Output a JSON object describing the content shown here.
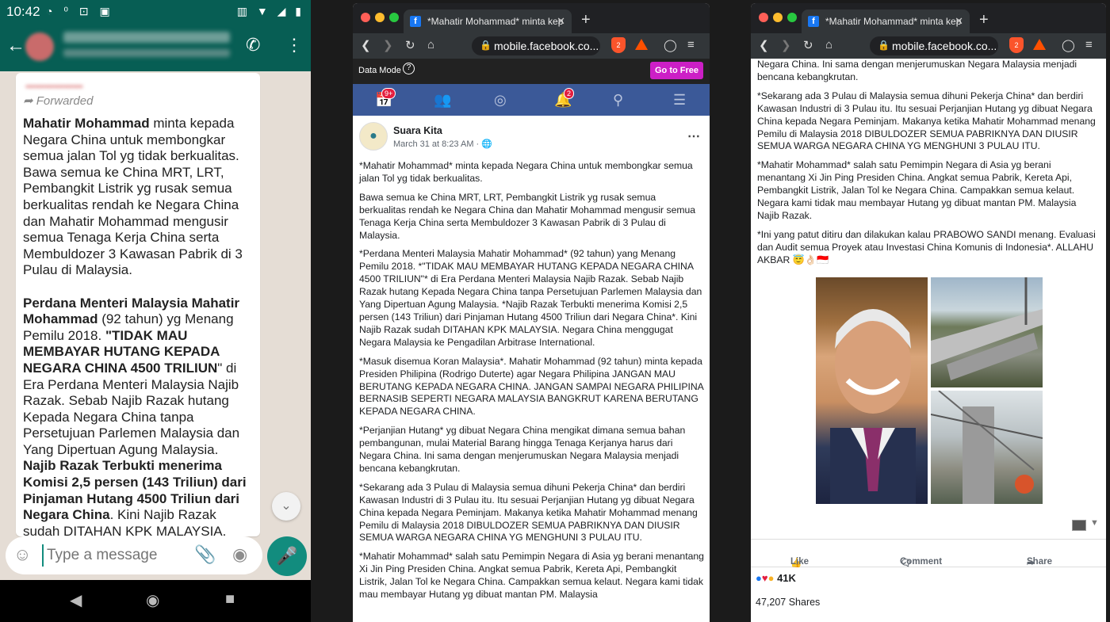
{
  "whatsapp": {
    "status_time": "10:42",
    "status_left_icons": "◔ ⁰ ⊡ ▣",
    "status_right_icons": "▥ ▼ ◢ ▮",
    "back_icon": "arrow-left-icon",
    "forwarded_label": "Forwarded",
    "message": {
      "p1_bold": "Mahatir Mohammad",
      "p1_rest": " minta kepada Negara China untuk membongkar semua jalan Tol yg tidak berkualitas. Bawa semua ke China MRT, LRT, Pembangkit Listrik yg rusak semua berkualitas rendah ke Negara China dan Mahatir Mohammad mengusir semua Tenaga Kerja China serta Membuldozer 3 Kawasan Pabrik di 3 Pulau di Malaysia.",
      "p2_bold": "Perdana Menteri Malaysia Mahatir Mohammad",
      "p2_a": " (92 tahun) yg Menang Pemilu 2018. ",
      "p2_bold2": "\"TIDAK MAU MEMBAYAR HUTANG KEPADA NEGARA CHINA 4500 TRILIUN",
      "p2_b": "\" di Era Perdana Menteri Malaysia Najib Razak. Sebab Najib Razak hutang Kepada Negara China tanpa Persetujuan Parlemen Malaysia dan Yang Dipertuan Agung Malaysia. ",
      "p2_bold3": "Najib Razak Terbukti menerima Komisi 2,5 persen (143 Triliun) dari Pinjaman Hutang 4500 Triliun dari Negara China",
      "p2_c": ". Kini Najib Razak sudah DITAHAN KPK MALAYSIA. Negara"
    },
    "input_placeholder": "Type a message",
    "nav": [
      "◀",
      "◉",
      "■"
    ]
  },
  "browser_left": {
    "tab_title": "*Mahatir Mohammad* minta kep",
    "url": "mobile.facebook.co...",
    "brave_count": "2",
    "data_mode_label": "Data Mode",
    "go_free_label": "Go to Free",
    "badge_home": "9+",
    "badge_notif": "2",
    "post": {
      "page_name": "Suara Kita",
      "date": "March 31 at 8:23 AM · ",
      "paragraphs": [
        "*Mahatir Mohammad* minta kepada Negara China untuk membongkar semua jalan Tol yg tidak berkualitas.",
        "Bawa semua ke China MRT, LRT, Pembangkit Listrik yg rusak semua berkualitas rendah ke Negara China dan Mahatir Mohammad mengusir semua Tenaga Kerja China serta Membuldozer 3 Kawasan Pabrik di 3 Pulau di Malaysia.",
        "*Perdana Menteri Malaysia Mahatir Mohammad* (92 tahun) yang Menang Pemilu 2018. *\"TIDAK MAU MEMBAYAR HUTANG KEPADA NEGARA CHINA 4500 TRILIUN\"* di Era Perdana Menteri Malaysia Najib Razak. Sebab Najib Razak hutang Kepada Negara China tanpa Persetujuan Parlemen Malaysia dan Yang Dipertuan Agung Malaysia. *Najib Razak Terbukti menerima Komisi 2,5 persen (143 Triliun) dari Pinjaman Hutang 4500 Triliun dari Negara China*. Kini Najib Razak sudah DITAHAN KPK MALAYSIA. Negara China menggugat Negara Malaysia ke Pengadilan Arbitrase International.",
        "*Masuk disemua Koran Malaysia*. Mahatir Mohammad (92 tahun) minta kepada Presiden Philipina (Rodrigo Duterte) agar Negara Philipina JANGAN MAU BERUTANG KEPADA NEGARA CHINA. JANGAN SAMPAI NEGARA PHILIPINA BERNASIB SEPERTI NEGARA MALAYSIA BANGKRUT KARENA BERUTANG KEPADA NEGARA CHINA.",
        "*Perjanjian Hutang* yg dibuat Negara China mengikat dimana semua bahan pembangunan, mulai Material Barang hingga Tenaga Kerjanya harus dari Negara China. Ini sama dengan menjerumuskan Negara Malaysia menjadi bencana kebangkrutan.",
        "*Sekarang ada 3 Pulau di Malaysia semua dihuni Pekerja China* dan berdiri Kawasan Industri di 3 Pulau itu. Itu sesuai Perjanjian Hutang yg dibuat Negara China kepada Negara Peminjam. Makanya ketika Mahatir Mohammad menang Pemilu di Malaysia 2018 DIBULDOZER SEMUA PABRIKNYA DAN DIUSIR SEMUA WARGA NEGARA CHINA YG MENGHUNI 3 PULAU ITU.",
        "*Mahatir Mohammad* salah satu Pemimpin Negara di Asia yg berani menantang Xi Jin Ping Presiden China. Angkat semua Pabrik, Kereta Api, Pembangkit Listrik, Jalan Tol ke Negara China. Campakkan semua kelaut. Negara kami tidak mau membayar Hutang yg dibuat mantan PM. Malaysia"
      ]
    }
  },
  "browser_right": {
    "tab_title": "*Mahatir Mohammad* minta kep",
    "url": "mobile.facebook.co...",
    "brave_count": "2",
    "paragraphs": [
      "Negara China. Ini sama dengan menjerumuskan Negara Malaysia menjadi bencana kebangkrutan.",
      "*Sekarang ada 3 Pulau di Malaysia semua dihuni Pekerja China* dan berdiri Kawasan Industri di 3 Pulau itu. Itu sesuai Perjanjian Hutang yg dibuat Negara China kepada Negara Peminjam. Makanya ketika Mahatir Mohammad menang Pemilu di Malaysia 2018 DIBULDOZER SEMUA PABRIKNYA DAN DIUSIR SEMUA WARGA NEGARA CHINA YG MENGHUNI 3 PULAU ITU.",
      "*Mahatir Mohammad* salah satu Pemimpin Negara di Asia yg berani menantang Xi Jin Ping Presiden China. Angkat semua Pabrik, Kereta Api, Pembangkit Listrik, Jalan Tol ke Negara China. Campakkan semua kelaut. Negara kami tidak mau membayar Hutang yg dibuat mantan PM. Malaysia Najib Razak.",
      "*Ini yang patut ditiru dan dilakukan kalau PRABOWO SANDI menang. Evaluasi dan Audit semua Proyek atau Investasi China Komunis di Indonesia*. ALLAHU AKBAR 😇👌🏻🇮🇩"
    ],
    "like_label": "Like",
    "comment_label": "Comment",
    "share_label": "Share",
    "reactions_count": "41K",
    "shares_text": "47,207 Shares"
  }
}
